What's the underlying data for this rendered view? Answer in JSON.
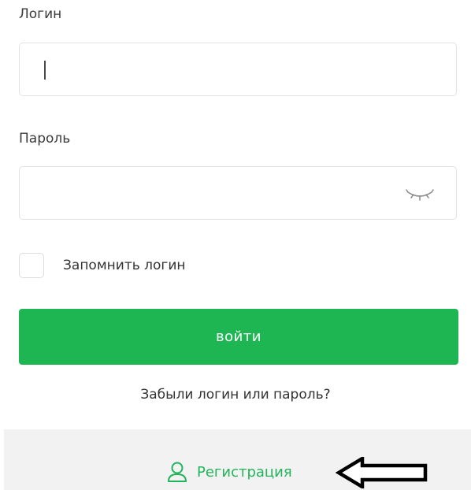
{
  "login": {
    "label": "Логин",
    "value": "",
    "placeholder": ""
  },
  "password": {
    "label": "Пароль",
    "value": "",
    "placeholder": "",
    "toggle_icon": "eye-closed-icon"
  },
  "remember": {
    "label": "Запомнить логин",
    "checked": false
  },
  "submit": {
    "label": "войти",
    "color": "#1db653"
  },
  "forgot": {
    "label": "Забыли логин или пароль?"
  },
  "register": {
    "label": "Регистрация",
    "icon": "user-icon",
    "color": "#22b45a"
  },
  "annotation": {
    "icon": "left-arrow-icon"
  }
}
